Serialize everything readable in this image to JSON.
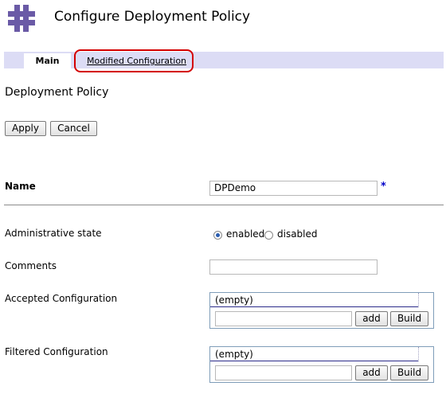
{
  "header": {
    "title": "Configure Deployment Policy",
    "logo_icon": "deployment-logo-icon"
  },
  "tabs": {
    "main": "Main",
    "modified": "Modified Configuration"
  },
  "section": {
    "heading": "Deployment Policy"
  },
  "actions": {
    "apply": "Apply",
    "cancel": "Cancel"
  },
  "form": {
    "name": {
      "label": "Name",
      "value": "DPDemo",
      "required_marker": "*"
    },
    "admin_state": {
      "label": "Administrative state",
      "options": [
        "enabled",
        "disabled"
      ],
      "selected": "enabled"
    },
    "comments": {
      "label": "Comments",
      "value": ""
    },
    "accepted": {
      "label": "Accepted Configuration",
      "list_item": "(empty)",
      "input_value": "",
      "add": "add",
      "build": "Build"
    },
    "filtered": {
      "label": "Filtered Configuration",
      "list_item": "(empty)",
      "input_value": "",
      "add": "add",
      "build": "Build"
    }
  },
  "colors": {
    "tab_bar": "#dcdcf5",
    "highlight": "#d40000",
    "required": "#0000c8",
    "logo": "#6a5aa6"
  }
}
